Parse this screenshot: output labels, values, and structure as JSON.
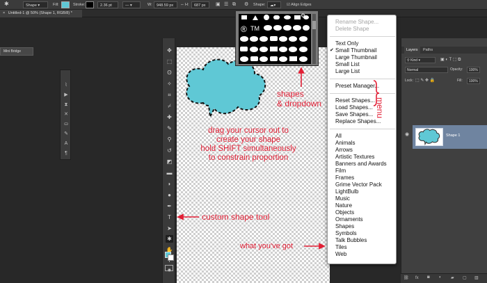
{
  "options_bar": {
    "mode": "Shape",
    "fill_label": "Fill:",
    "stroke_label": "Stroke:",
    "stroke_width": "2.36 pt",
    "width_label": "W:",
    "width_value": "948.59 px",
    "height_label": "H:",
    "height_value": "687 px",
    "shape_label": "Shape:",
    "align_edges_label": "Align Edges",
    "fill_color": "#5fc8d5",
    "stroke_color": "#000000"
  },
  "document_tab": {
    "title": "Untitled-1 @ 50% (Shape 1, RGB/8) *",
    "close_glyph": "×"
  },
  "mini_bridge": {
    "label": "Mini Bridge"
  },
  "shape_picker": {
    "label_glyphs": [
      "®",
      "TM"
    ]
  },
  "menu": {
    "items_top": [
      "Rename Shape...",
      "Delete Shape"
    ],
    "view_items": [
      "Text Only",
      "Small Thumbnail",
      "Large Thumbnail",
      "Small List",
      "Large List"
    ],
    "checked_item": "Small Thumbnail",
    "preset_manager": "Preset Manager...",
    "shape_actions": [
      "Reset Shapes...",
      "Load Shapes...",
      "Save Shapes...",
      "Replace Shapes..."
    ],
    "categories": [
      "All",
      "Animals",
      "Arrows",
      "Artistic Textures",
      "Banners and Awards",
      "Film",
      "Frames",
      "Grime Vector Pack",
      "LightBulb",
      "Music",
      "Nature",
      "Objects",
      "Ornaments",
      "Shapes",
      "Symbols",
      "Talk Bubbles",
      "Tiles",
      "Web"
    ]
  },
  "annotations": {
    "shapes_dropdown": [
      "shapes",
      "& dropdown"
    ],
    "menu": "menu",
    "drag_instruction": [
      "drag your cursor out to",
      "create your shape",
      "hold SHIFT simultaneously",
      "to constrain proportion"
    ],
    "custom_shape_tool": "custom shape tool",
    "what_youve_got": "what you've got",
    "color": "#e21f35"
  },
  "layers_panel": {
    "tabs": [
      "Layers",
      "Paths"
    ],
    "kind_label": "Kind",
    "blend_mode": "Normal",
    "opacity_label": "Opacity:",
    "opacity_value": "100%",
    "lock_label": "Lock:",
    "fill_label": "Fill:",
    "fill_value": "100%",
    "layer_name": "Shape 1",
    "footer_icons": [
      "link-icon",
      "fx-icon",
      "mask-icon",
      "adjustment-icon",
      "folder-icon",
      "new-layer-icon",
      "trash-icon"
    ],
    "footer_labels": [
      "fx"
    ]
  },
  "colors": {
    "cloud_fill": "#5fc8d5",
    "foreground": "#5fc8d5",
    "background": "#ffffff",
    "selected_layer": "#6f84a0"
  }
}
